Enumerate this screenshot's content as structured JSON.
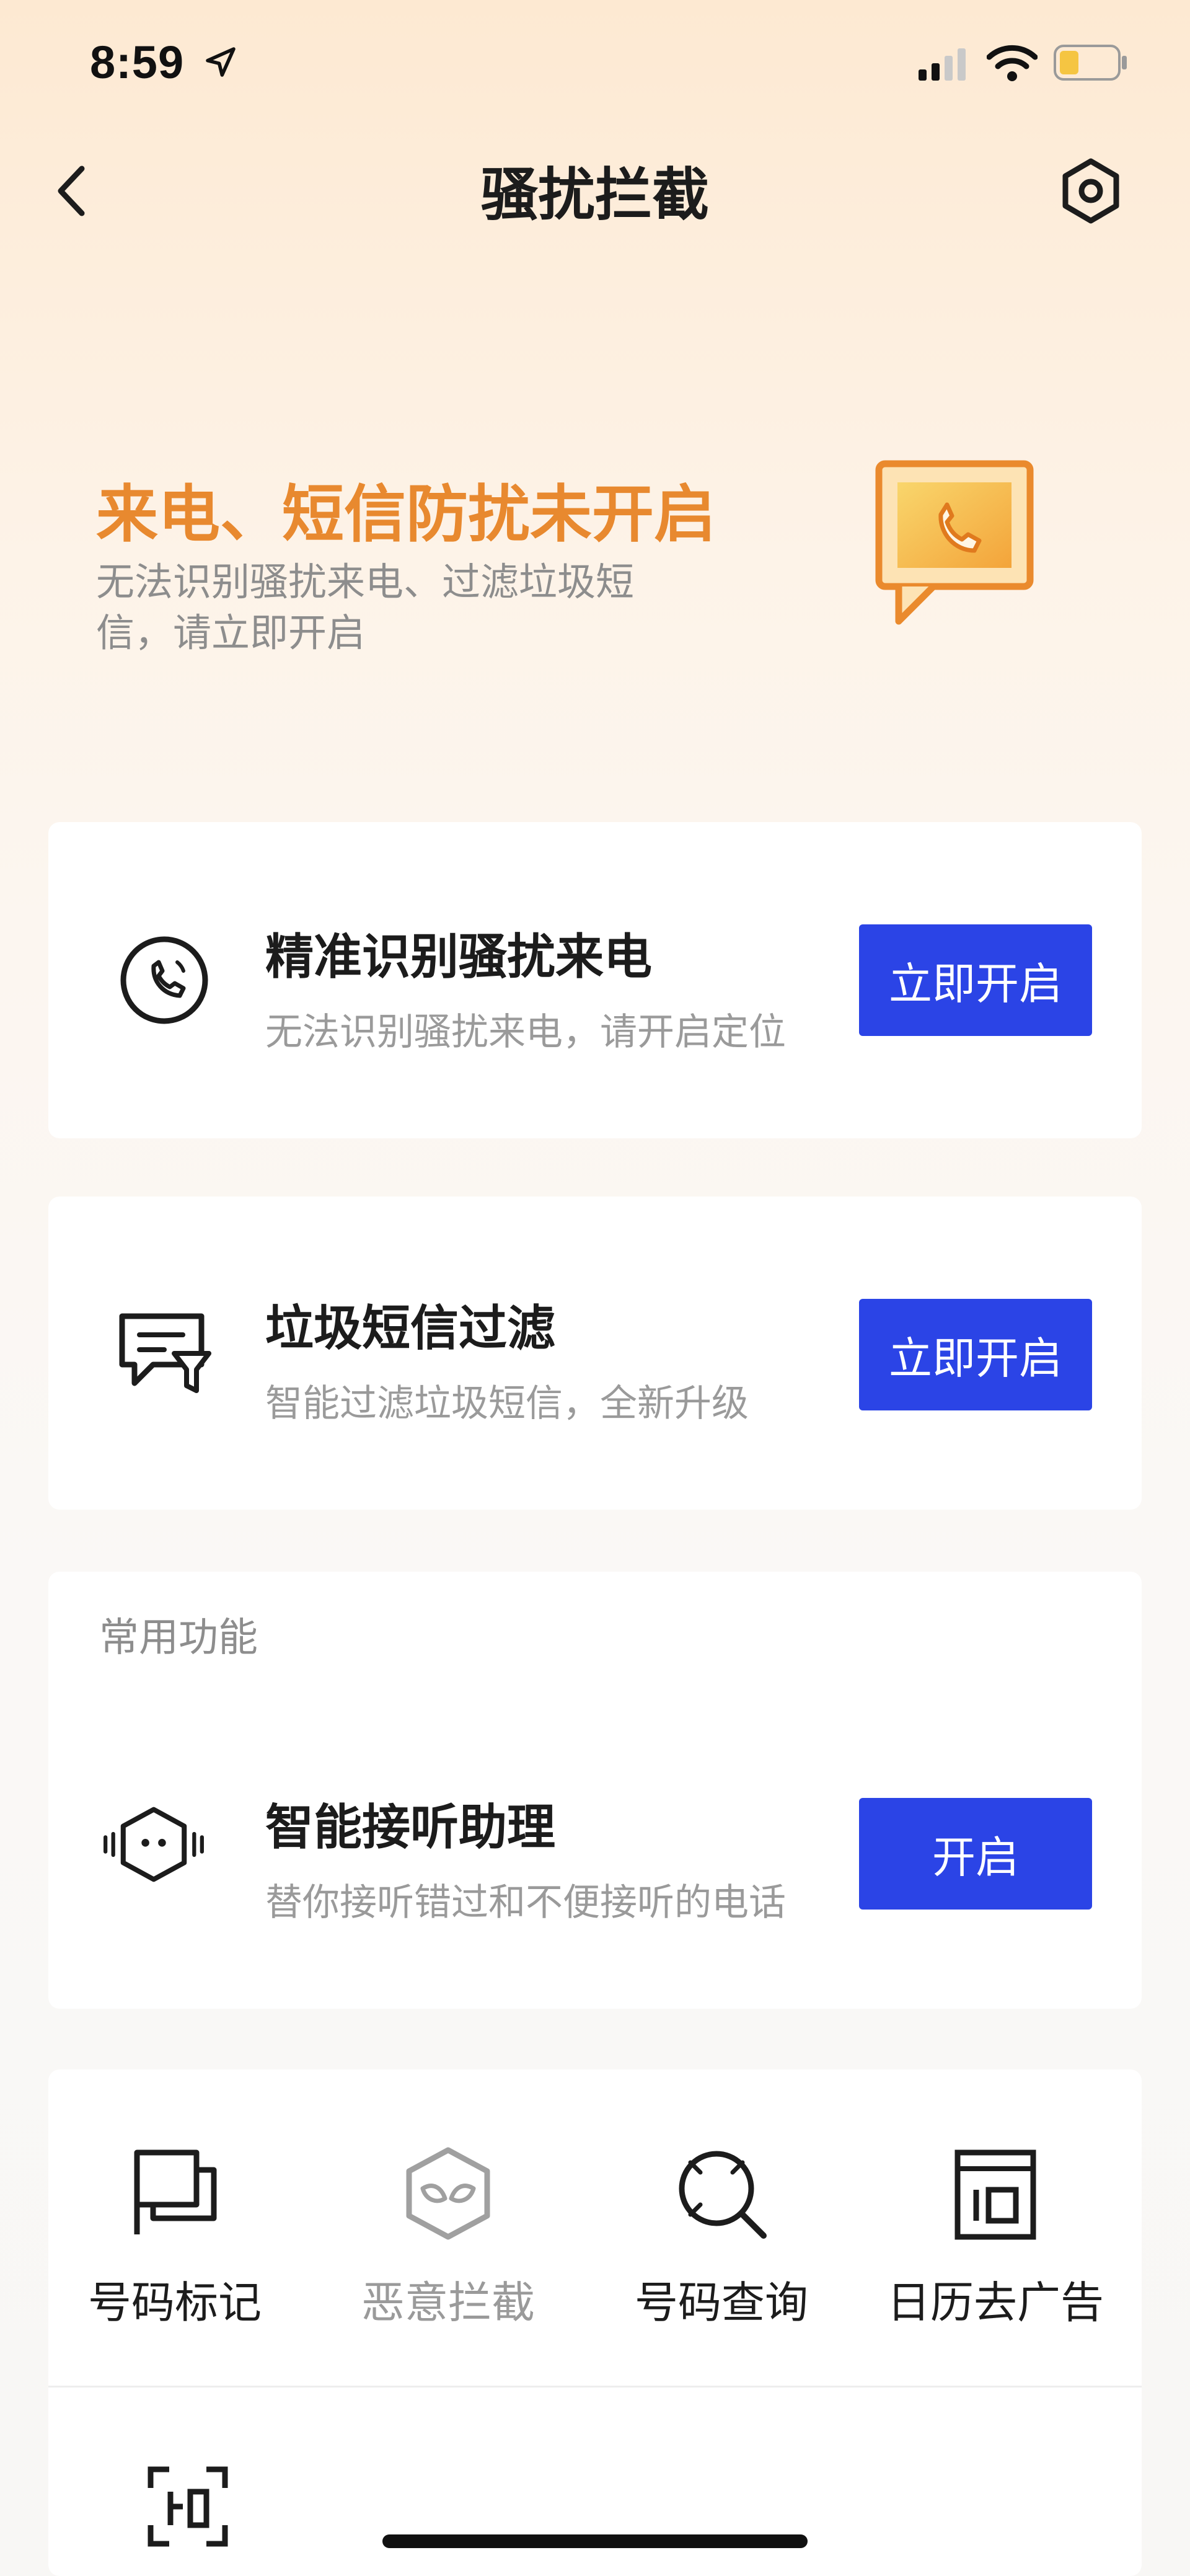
{
  "status_bar": {
    "time": "8:59"
  },
  "nav": {
    "title": "骚扰拦截",
    "back_icon": "chevron-left-icon",
    "settings_icon": "gear-icon"
  },
  "hero": {
    "title": "来电、短信防扰未开启",
    "subtitle": "无法识别骚扰来电、过滤垃圾短信，请立即开启",
    "icon": "phone-chat-icon"
  },
  "cards": [
    {
      "title": "精准识别骚扰来电",
      "subtitle": "无法识别骚扰来电，请开启定位",
      "button": "立即开启",
      "icon": "phone-circle-icon"
    },
    {
      "title": "垃圾短信过滤",
      "subtitle": "智能过滤垃圾短信，全新升级",
      "button": "立即开启",
      "icon": "message-filter-icon"
    }
  ],
  "common": {
    "header": "常用功能",
    "item": {
      "title": "智能接听助理",
      "subtitle": "替你接听错过和不便接听的电话",
      "button": "开启",
      "icon": "robot-icon"
    }
  },
  "tools": [
    {
      "label": "号码标记",
      "icon": "flag-icon",
      "enabled": true
    },
    {
      "label": "恶意拦截",
      "icon": "mask-shield-icon",
      "enabled": false
    },
    {
      "label": "号码查询",
      "icon": "search-number-icon",
      "enabled": true
    },
    {
      "label": "日历去广告",
      "icon": "calendar-icon",
      "enabled": true
    }
  ],
  "colors": {
    "accent_orange": "#e8892f",
    "primary_blue": "#2b44e6"
  }
}
